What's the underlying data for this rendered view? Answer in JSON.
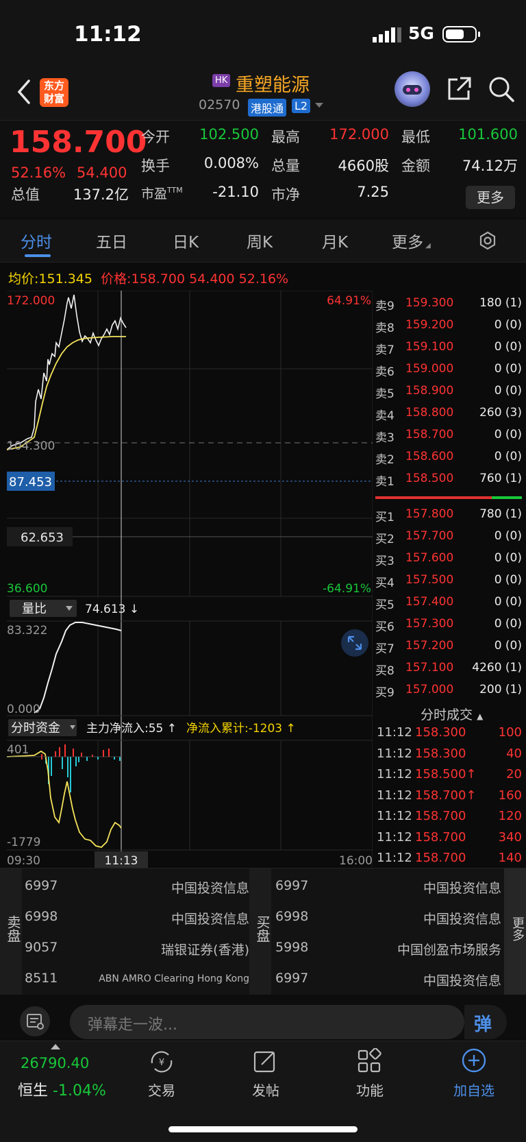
{
  "status": {
    "time": "11:12",
    "network": "5G"
  },
  "header": {
    "logo": "东方财富",
    "market_tag": "HK",
    "stock_name": "重塑能源",
    "stock_code": "02570",
    "badge": "港股通",
    "level": "L2"
  },
  "quote": {
    "price": "158.700",
    "change_pct": "52.16%",
    "change": "54.400",
    "fields": [
      {
        "label": "今开",
        "value": "102.500"
      },
      {
        "label": "最高",
        "value": "172.000"
      },
      {
        "label": "最低",
        "value": "101.600"
      },
      {
        "label": "换手",
        "value": "0.008%"
      },
      {
        "label": "总量",
        "value": "4660股"
      },
      {
        "label": "金额",
        "value": "74.12万"
      },
      {
        "label": "总值",
        "value": "137.2亿"
      },
      {
        "label": "市盈",
        "sup": "TTM",
        "value": "-21.10"
      },
      {
        "label": "市净",
        "value": "7.25"
      }
    ],
    "more": "更多"
  },
  "tabs": [
    "分时",
    "五日",
    "日K",
    "周K",
    "月K",
    "更多"
  ],
  "price_info": {
    "avg_label": "均价:",
    "avg": "151.345",
    "price_label": "价格:",
    "price": "158.700",
    "change": "54.400",
    "pct": "52.16%"
  },
  "chart_data": {
    "type": "line",
    "x_start": "09:30",
    "x_end": "16:00",
    "cursor_time": "11:13",
    "y_top": "172.000",
    "y_bottom": "36.600",
    "pct_top": "64.91%",
    "pct_bottom": "-64.91%",
    "prev_close": "104.300",
    "cursor_price": "87.453",
    "ref_price": "62.653",
    "series": [],
    "volume_ratio": {
      "label": "量比",
      "value": "74.613 ↓",
      "max": "83.322",
      "min": "0.000"
    },
    "fund": {
      "label": "分时资金",
      "main_label": "主力净流入:55 ↑",
      "cum_label": "净流入累计:-1203 ↑",
      "max": "401",
      "min": "-1779"
    }
  },
  "order_book": {
    "sell": [
      {
        "label": "卖9",
        "price": "159.300",
        "vol": "180 (1)"
      },
      {
        "label": "卖8",
        "price": "159.200",
        "vol": "0 (0)"
      },
      {
        "label": "卖7",
        "price": "159.100",
        "vol": "0 (0)"
      },
      {
        "label": "卖6",
        "price": "159.000",
        "vol": "0 (0)"
      },
      {
        "label": "卖5",
        "price": "158.900",
        "vol": "0 (0)"
      },
      {
        "label": "卖4",
        "price": "158.800",
        "vol": "260 (3)"
      },
      {
        "label": "卖3",
        "price": "158.700",
        "vol": "0 (0)"
      },
      {
        "label": "卖2",
        "price": "158.600",
        "vol": "0 (0)"
      },
      {
        "label": "卖1",
        "price": "158.500",
        "vol": "760 (1)"
      }
    ],
    "buy": [
      {
        "label": "买1",
        "price": "157.800",
        "vol": "780 (1)"
      },
      {
        "label": "买2",
        "price": "157.700",
        "vol": "0 (0)"
      },
      {
        "label": "买3",
        "price": "157.600",
        "vol": "0 (0)"
      },
      {
        "label": "买4",
        "price": "157.500",
        "vol": "0 (0)"
      },
      {
        "label": "买5",
        "price": "157.400",
        "vol": "0 (0)"
      },
      {
        "label": "买6",
        "price": "157.300",
        "vol": "0 (0)"
      },
      {
        "label": "买7",
        "price": "157.200",
        "vol": "0 (0)"
      },
      {
        "label": "买8",
        "price": "157.100",
        "vol": "4260 (1)"
      },
      {
        "label": "买9",
        "price": "157.000",
        "vol": "200 (1)"
      }
    ]
  },
  "ticks": {
    "title": "分时成交",
    "rows": [
      {
        "time": "11:12",
        "price": "158.300",
        "vol": "100"
      },
      {
        "time": "11:12",
        "price": "158.300",
        "vol": "40"
      },
      {
        "time": "11:12",
        "price": "158.500↑",
        "vol": "20"
      },
      {
        "time": "11:12",
        "price": "158.700↑",
        "vol": "160"
      },
      {
        "time": "11:12",
        "price": "158.700",
        "vol": "120"
      },
      {
        "time": "11:12",
        "price": "158.700",
        "vol": "340"
      },
      {
        "time": "11:12",
        "price": "158.700",
        "vol": "140"
      }
    ]
  },
  "brokers": {
    "sell_label": "卖盘",
    "buy_label": "买盘",
    "more_label": "更多",
    "sell": [
      {
        "id": "6997",
        "name": "中国投资信息"
      },
      {
        "id": "6998",
        "name": "中国投资信息"
      },
      {
        "id": "9057",
        "name": "瑞银证券(香港)"
      },
      {
        "id": "8511",
        "name": "ABN AMRO Clearing Hong Kong"
      }
    ],
    "buy": [
      {
        "id": "6997",
        "name": "中国投资信息"
      },
      {
        "id": "6998",
        "name": "中国投资信息"
      },
      {
        "id": "5998",
        "name": "中国创盈市场服务"
      },
      {
        "id": "6997",
        "name": "中国投资信息"
      }
    ]
  },
  "comment": {
    "placeholder": "弹幕走一波...",
    "danmu": "弹"
  },
  "nav": {
    "index_value": "26790.40",
    "index_name": "恒生",
    "index_pct": "-1.04%",
    "items": [
      "交易",
      "发帖",
      "功能",
      "加自选"
    ]
  }
}
